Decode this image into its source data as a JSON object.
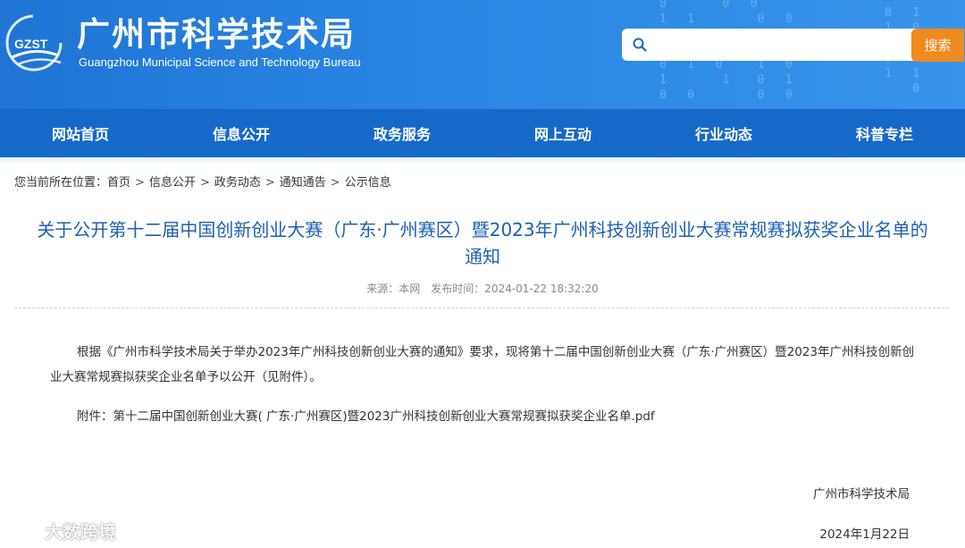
{
  "header": {
    "logo_text": "GZST",
    "title": "广州市科学技术局",
    "subtitle": "Guangzhou Municipal Science and Technology Bureau",
    "search_placeholder": "",
    "search_button": "搜索"
  },
  "nav": {
    "items": [
      "网站首页",
      "信息公开",
      "政务服务",
      "网上互动",
      "行业动态",
      "科普专栏"
    ]
  },
  "breadcrumb": {
    "prefix": "您当前所在位置：",
    "items": [
      "首页",
      "信息公开",
      "政务动态",
      "通知通告",
      "公示信息"
    ],
    "separator": ">"
  },
  "article": {
    "title": "关于公开第十二届中国创新创业大赛（广东·广州赛区）暨2023年广州科技创新创业大赛常规赛拟获奖企业名单的通知",
    "source_label": "来源：",
    "source": "本网",
    "publish_label": "发布时间：",
    "publish_time": "2024-01-22 18:32:20",
    "paragraph1": "根据《广州市科学技术局关于举办2023年广州科技创新创业大赛的通知》要求，现将第十二届中国创新创业大赛（广东·广州赛区）暨2023年广州科技创新创业大赛常规赛拟获奖企业名单予以公开（见附件）。",
    "attachment_label": "附件：",
    "attachment": "第十二届中国创新创业大赛( 广东·广州赛区)暨2023广州科技创新创业大赛常规赛拟获奖企业名单.pdf",
    "signature": "广州市科学技术局",
    "date": "2024年1月22日"
  },
  "watermark": {
    "text": "大数跨境"
  },
  "colors": {
    "header_blue": "#2a86e2",
    "nav_blue": "#1769c9",
    "title_blue": "#1d5fb5",
    "search_orange": "#ef8a1e"
  }
}
